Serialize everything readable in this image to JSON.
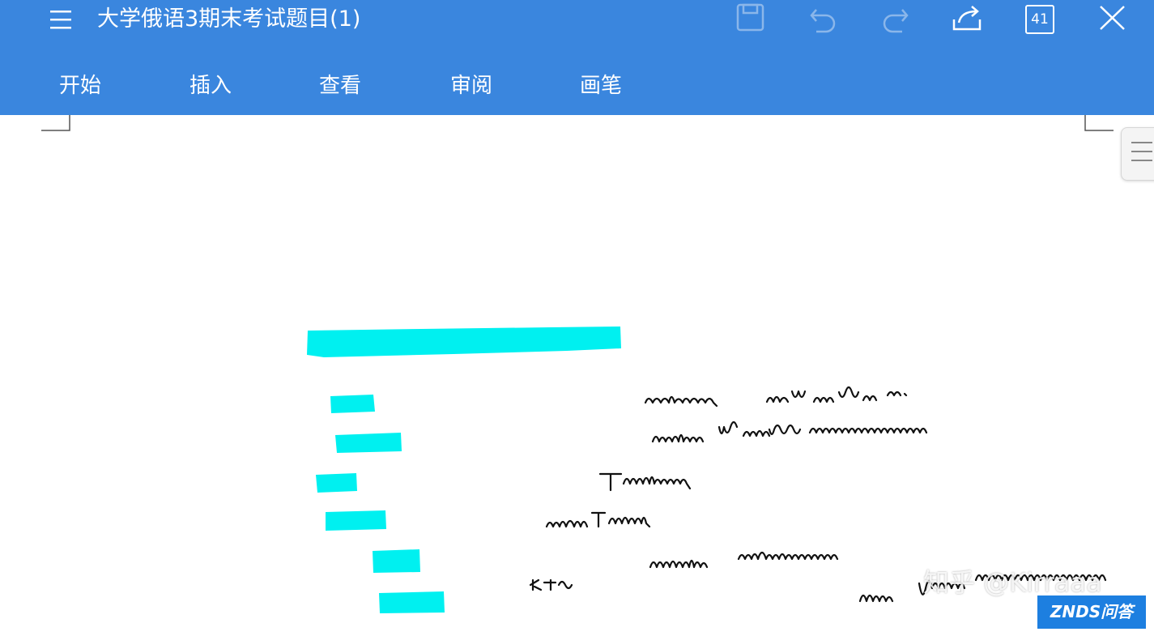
{
  "app": {
    "title": "大学俄语3期末考试题目(1)",
    "page_count": "41",
    "accent_color": "#3a86de"
  },
  "toolbar": {
    "icons": [
      "menu-icon",
      "save-icon",
      "undo-icon",
      "redo-icon",
      "share-icon",
      "page-count-icon",
      "close-icon"
    ]
  },
  "tabs": [
    {
      "label": "开始"
    },
    {
      "label": "插入"
    },
    {
      "label": "查看"
    },
    {
      "label": "审阅"
    },
    {
      "label": "画笔"
    }
  ],
  "document": {
    "highlight_color": "#00f0f0",
    "handwriting": [
      "сообщение, брат купил себе ...",
      "надежда брат хотел меня ...",
      "требовал",
      "советовал",
      "передал информацию",
      "参加",
      "мне купил ..."
    ]
  },
  "watermarks": {
    "zhihu": "知乎 @Kirraaa",
    "znds": "ZNDS问答"
  }
}
